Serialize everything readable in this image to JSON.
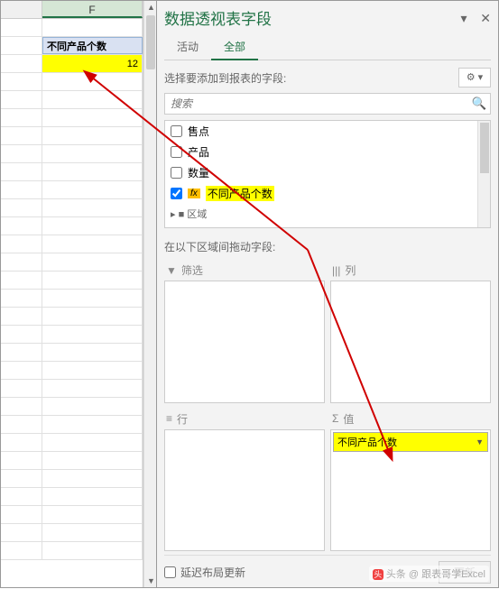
{
  "sheet": {
    "col_label": "F",
    "pivot_header": "不同产品个数",
    "pivot_value": "12"
  },
  "pane": {
    "title": "数据透视表字段",
    "tabs": {
      "active": "活动",
      "all": "全部"
    },
    "add_label": "选择要添加到报表的字段:",
    "search_placeholder": "搜索",
    "fields": [
      {
        "label": "售点",
        "checked": false,
        "fx": false
      },
      {
        "label": "产品",
        "checked": false,
        "fx": false
      },
      {
        "label": "数量",
        "checked": false,
        "fx": false
      },
      {
        "label": "不同产品个数",
        "checked": true,
        "fx": true
      }
    ],
    "truncated": "▸ ■ 区域",
    "drag_label": "在以下区域间拖动字段:",
    "areas": {
      "filter": "筛选",
      "columns": "列",
      "rows": "行",
      "values": "值",
      "value_item": "不同产品个数"
    },
    "defer_label": "延迟布局更新",
    "update_btn": "更新"
  },
  "watermark": "头条 @ 跟表哥学Excel"
}
